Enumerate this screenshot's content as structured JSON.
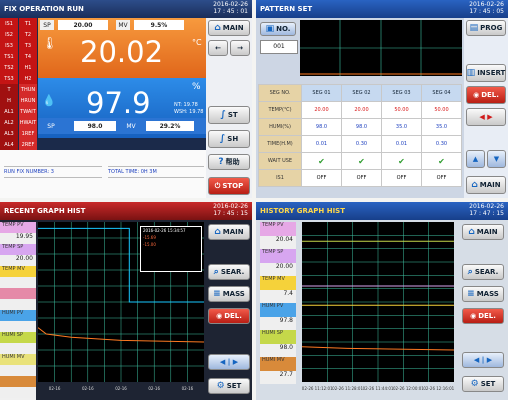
{
  "q1": {
    "title": "FIX OPERATION RUN",
    "date": "2016-02-26",
    "time": "17 : 45 : 01",
    "alarms": [
      [
        "IS1",
        "T1"
      ],
      [
        "IS2",
        "T2"
      ],
      [
        "IS3",
        "T3"
      ],
      [
        "TS1",
        "T4"
      ],
      [
        "TS2",
        "H1"
      ],
      [
        "TS3",
        "H2"
      ],
      [
        "T",
        "THUN"
      ],
      [
        "H",
        "HRUN"
      ],
      [
        "AL1",
        "TWAIT"
      ],
      [
        "AL2",
        "HWAIT"
      ],
      [
        "AL3",
        "1REF"
      ],
      [
        "AL4",
        "2REF"
      ]
    ],
    "sp_label": "SP",
    "mv_label": "MV",
    "temp_sp": "20.00",
    "temp_mv": "9.5%",
    "temp_pv": "20.02",
    "temp_unit": "°C",
    "hum_pv": "97.9",
    "hum_unit": "%",
    "nt": "NT: 19.78",
    "wsh": "WSH: 19.78",
    "hum_sp": "98.0",
    "hum_mv": "29.2%",
    "run_fix_number": "RUN FIX NUMBER:  3",
    "total_time": "TOTAL TIME:     0H 3M",
    "btn_main": "MAIN",
    "btn_st": "ST",
    "btn_sh": "SH",
    "btn_help": "帮助",
    "btn_stop": "STOP"
  },
  "q2": {
    "title": "PATTERN SET",
    "date": "2016-02-26",
    "time": "17 : 45 : 05",
    "no_label": "NO.",
    "no_value": "001",
    "columns": [
      "SEG NO.",
      "SEG 01",
      "SEG 02",
      "SEG 03",
      "SEG 04"
    ],
    "rows": [
      {
        "label": "TEMP(℃)",
        "values": [
          "20.00",
          "20.00",
          "50.00",
          "50.00"
        ],
        "kind": "red"
      },
      {
        "label": "HUMI(%)",
        "values": [
          "98.0",
          "98.0",
          "35.0",
          "35.0"
        ],
        "kind": "blue"
      },
      {
        "label": "TIME(H.M)",
        "values": [
          "0.01",
          "0.30",
          "0.01",
          "0.30"
        ],
        "kind": "blue"
      },
      {
        "label": "WAIT USE",
        "values": [
          "✔",
          "✔",
          "✔",
          "✔"
        ],
        "kind": "check"
      },
      {
        "label": "IS1",
        "values": [
          "OFF",
          "OFF",
          "OFF",
          "OFF"
        ],
        "kind": "plain"
      }
    ],
    "btn_prog": "PROG",
    "btn_insert": "INSERT",
    "btn_del": "DEL.",
    "btn_main": "MAIN"
  },
  "q3": {
    "title": "RECENT GRAPH HIST",
    "date": "2016-02-26",
    "time": "17 : 45 : 15",
    "legend": [
      {
        "tag": "TEMP PV",
        "value": "19.95",
        "color": "#e6a8e6"
      },
      {
        "tag": "TEMP SP",
        "value": "20.00",
        "color": "#d7a6f0"
      },
      {
        "tag": "TEMP MV",
        "value": "",
        "color": "#f5d23a"
      },
      {
        "tag": "",
        "value": "",
        "color": "#e58aa8"
      },
      {
        "tag": "HUMI PV",
        "value": "",
        "color": "#4aa3e8"
      },
      {
        "tag": "HUMI SP",
        "value": "",
        "color": "#c5d84a"
      },
      {
        "tag": "HUMI MV",
        "value": "",
        "color": "#e9e27a"
      },
      {
        "tag": "",
        "value": "",
        "color": "#d88a3a"
      }
    ],
    "cursor_box": {
      "time": "2016-02-26 15:34:57",
      "lines": [
        "-15.69",
        "-15.00",
        "",
        ""
      ]
    },
    "x_ticks": [
      "02-16",
      "02-16",
      "02-16",
      "02-16",
      "02-16"
    ],
    "btn_main": "MAIN",
    "btn_sear": "SEAR.",
    "btn_mass": "MASS",
    "btn_del": "DEL.",
    "btn_set": "SET",
    "colors": {
      "sp_line": "#18c8ff",
      "pv_line": "#ff7a22",
      "grid": "#3fc4a4"
    }
  },
  "q4": {
    "title": "HISTORY GRAPH HIST",
    "date": "2016-02-26",
    "time": "17 : 47 : 15",
    "legend": [
      {
        "tag": "TEMP PV",
        "value": "20.04",
        "color": "#e6a8e6"
      },
      {
        "tag": "TEMP SP",
        "value": "20.00",
        "color": "#d7a6f0"
      },
      {
        "tag": "TEMP MV",
        "value": "7.4",
        "color": "#f5d23a"
      },
      {
        "tag": "HUMI PV",
        "value": "97.8",
        "color": "#4aa3e8"
      },
      {
        "tag": "HUMI SP",
        "value": "98.0",
        "color": "#c5d84a"
      },
      {
        "tag": "HUMI MV",
        "value": "27.7",
        "color": "#d88a3a"
      }
    ],
    "x_ticks": [
      "02-26 11:12:01",
      "02-26 11:28:01",
      "02-26 11:44:01",
      "02-26 12:00:01",
      "02-26 12:16:01"
    ],
    "btn_main": "MAIN",
    "btn_sear": "SEAR.",
    "btn_mass": "MASS",
    "btn_del": "DEL.",
    "btn_set": "SET"
  }
}
